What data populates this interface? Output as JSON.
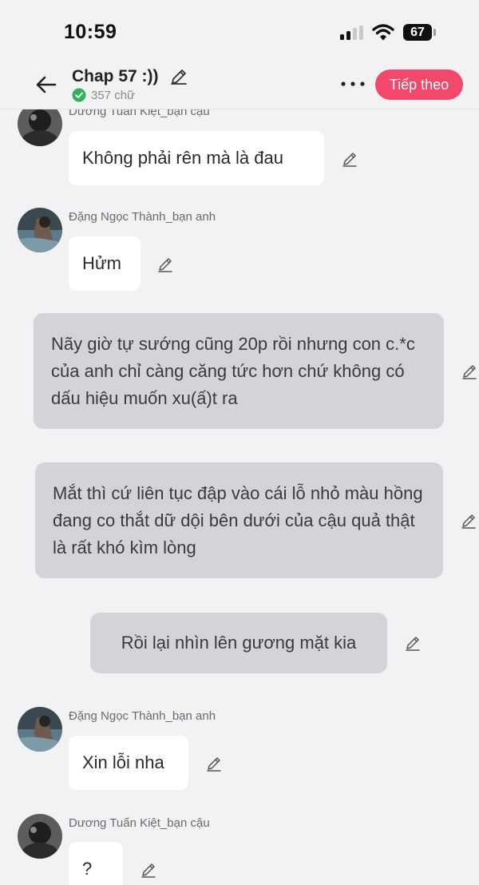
{
  "status_bar": {
    "time": "10:59",
    "battery": "67"
  },
  "header": {
    "title": "Chap 57 :))",
    "word_count": "357 chữ",
    "next_button": "Tiếp theo"
  },
  "messages": [
    {
      "sender": "Dương Tuấn Kiệt_bạn cậu",
      "text": "Không phải rên mà là đau"
    },
    {
      "sender": "Đặng Ngọc Thành_bạn anh",
      "text": "Hửm"
    },
    {
      "text": "Nãy giờ tự sướng cũng 20p rồi nhưng con c.*c của anh chỉ càng căng tức hơn chứ không có dấu hiệu muốn xu(ấ)t ra"
    },
    {
      "text": "Mắt thì cứ liên tục đập vào cái lỗ nhỏ màu hồng đang co thắt dữ dội bên dưới của cậu quả thật là rất khó kìm lòng"
    },
    {
      "text": "Rồi lại nhìn lên gương mặt kia"
    },
    {
      "sender": "Đặng Ngọc Thành_bạn anh",
      "text": "Xin lỗi nha"
    },
    {
      "sender": "Dương Tuấn Kiệt_bạn cậu",
      "text": "?"
    }
  ],
  "colors": {
    "accent": "#f2486b",
    "narration_bubble": "#d4d4d8",
    "background": "#f2f2f4",
    "check": "#2fb35a"
  },
  "icons": [
    "back-arrow-icon",
    "pencil-icon",
    "check-circle-icon",
    "more-dots-icon",
    "wifi-icon",
    "signal-icon",
    "battery-icon"
  ]
}
